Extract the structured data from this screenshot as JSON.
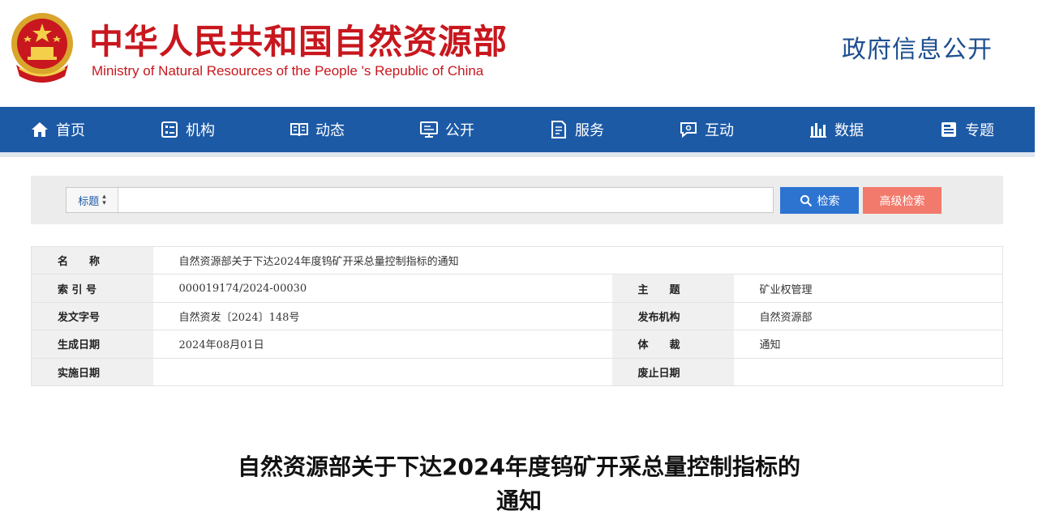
{
  "header": {
    "title": "中华人民共和国自然资源部",
    "subtitle": "Ministry of Natural Resources of the People 's Republic of China",
    "gov_info": "政府信息公开"
  },
  "nav": {
    "items": [
      {
        "label": "首页",
        "icon": "home-icon"
      },
      {
        "label": "机构",
        "icon": "org-icon"
      },
      {
        "label": "动态",
        "icon": "news-icon"
      },
      {
        "label": "公开",
        "icon": "monitor-icon"
      },
      {
        "label": "服务",
        "icon": "service-icon"
      },
      {
        "label": "互动",
        "icon": "chat-icon"
      },
      {
        "label": "数据",
        "icon": "bar-chart-icon"
      },
      {
        "label": "专题",
        "icon": "topic-icon"
      }
    ]
  },
  "search": {
    "select_value": "标题",
    "input_value": "",
    "search_label": "检索",
    "advanced_label": "高级检索",
    "search_color": "#2d74d1",
    "advanced_color": "#f27a6c"
  },
  "info": {
    "name_label": "名　　称",
    "name_value": "自然资源部关于下达2024年度钨矿开采总量控制指标的通知",
    "index_label": "索 引 号",
    "index_value": "000019174/2024-00030",
    "topic_label": "主　　题",
    "topic_value": "矿业权管理",
    "docno_label": "发文字号",
    "docno_value": "自然资发〔2024〕148号",
    "issuer_label": "发布机构",
    "issuer_value": "自然资源部",
    "created_label": "生成日期",
    "created_value": "2024年08月01日",
    "genre_label": "体　　裁",
    "genre_value": "通知",
    "effective_label": "实施日期",
    "effective_value": "",
    "expiry_label": "废止日期",
    "expiry_value": ""
  },
  "document": {
    "title_line1": "自然资源部关于下达2024年度钨矿开采总量控制指标的",
    "title_line2": "通知"
  },
  "colors": {
    "brand_red": "#c8171e",
    "nav_blue": "#1d5aa6"
  }
}
